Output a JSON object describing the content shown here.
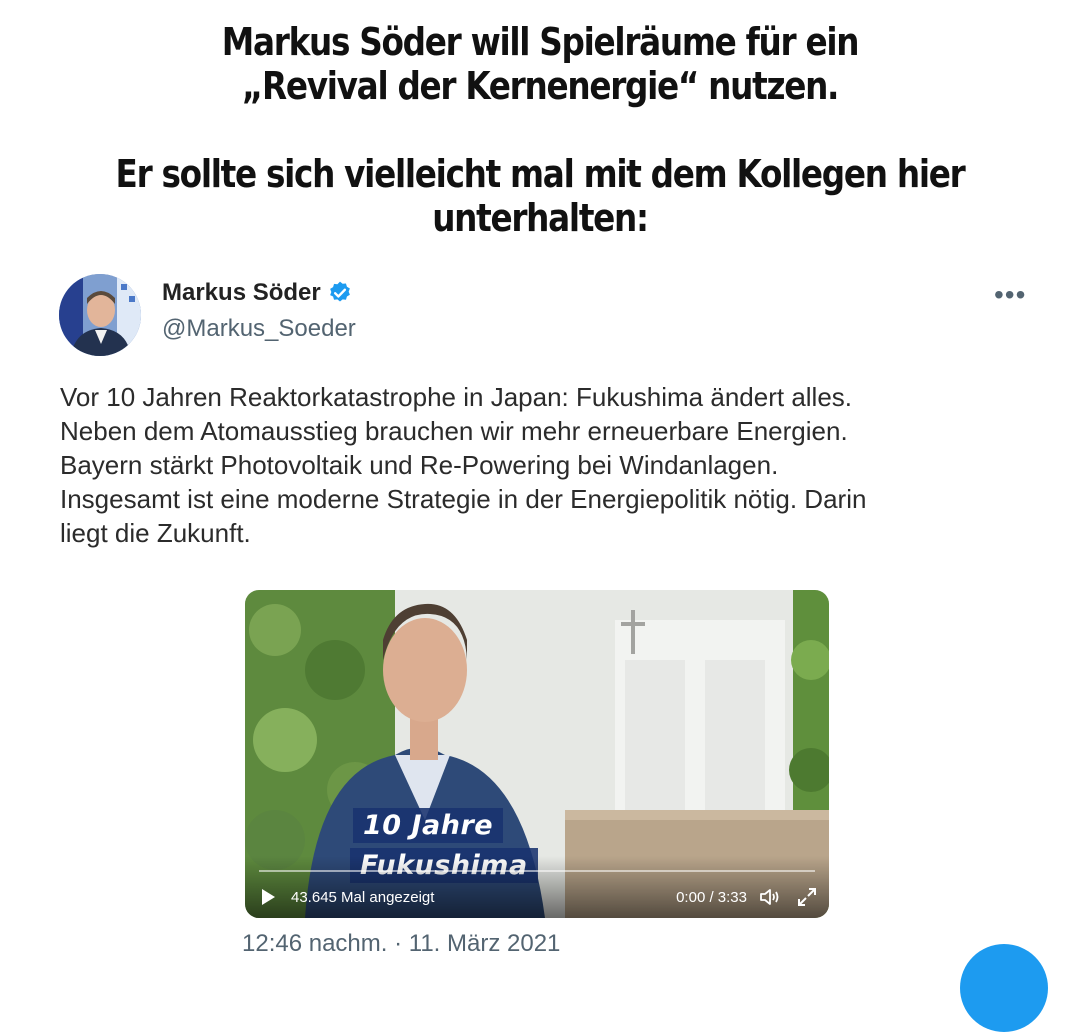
{
  "headline": {
    "line1": "Markus Söder will Spielräume für ein",
    "line2": "„Revival der Kernenergie“ nutzen.",
    "line3": "Er sollte sich vielleicht mal mit dem Kollegen hier",
    "line4": "unterhalten:"
  },
  "tweet": {
    "author_name": "Markus Söder",
    "handle": "@Markus_Soeder",
    "more_icon": "more-icon",
    "verified_icon": "verified-badge-icon",
    "text_lines": [
      "Vor 10 Jahren Reaktorkatastrophe in Japan: Fukushima ändert alles.",
      "Neben dem Atomausstieg brauchen wir mehr erneuerbare Energien.",
      "Bayern stärkt Photovoltaik und Re-Powering bei Windanlagen.",
      "Insgesamt ist eine moderne Strategie in der Energiepolitik nötig. Darin",
      "liegt die Zukunft."
    ],
    "timestamp": "12:46 nachm. · 11. März 2021"
  },
  "video": {
    "overlay_line1": "10 Jahre",
    "overlay_line2": "Fukushima",
    "views": "43.645 Mal angezeigt",
    "time": "0:00 / 3:33",
    "progress_fraction": 0
  },
  "colors": {
    "accent": "#1d9bf0",
    "secondary_text": "#536471",
    "overlay_blue": "#19326e"
  }
}
